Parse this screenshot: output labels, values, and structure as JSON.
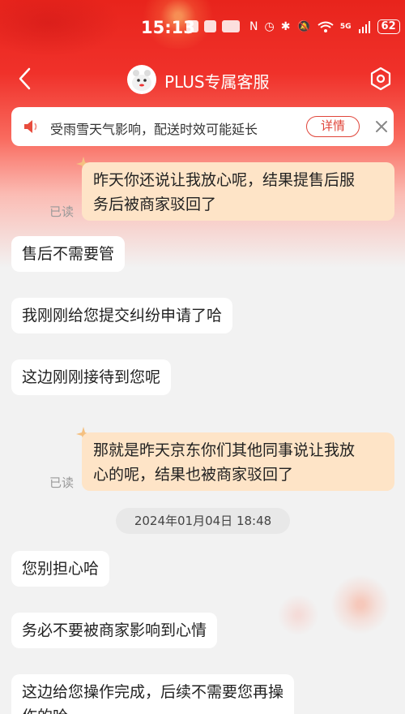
{
  "status_bar": {
    "time": "15:13",
    "battery": "62",
    "network": "5G"
  },
  "nav": {
    "title": "PLUS专属客服",
    "icons": [
      "back-icon",
      "avatar",
      "settings-icon"
    ]
  },
  "notice": {
    "text": "受雨雪天气影响，配送时效可能延长",
    "detail_label": "详情",
    "icons": [
      "speaker-icon",
      "close-icon"
    ]
  },
  "messages": [
    {
      "side": "right",
      "text_lines": [
        "昨天你还说让我放心呢，结果提售后服",
        "务后被商家驳回了"
      ],
      "read": "已读"
    },
    {
      "side": "left",
      "text": "售后不需要管"
    },
    {
      "side": "left",
      "text": "我刚刚给您提交纠纷申请了哈"
    },
    {
      "side": "left",
      "text": "这边刚刚接待到您呢"
    },
    {
      "side": "right",
      "text_lines": [
        "那就是昨天京东你们其他同事说让我放",
        "心的呢，结果也被商家驳回了"
      ],
      "read": "已读"
    },
    {
      "side": "time",
      "text": "2024年01月04日  18:48"
    },
    {
      "side": "left",
      "text": "您别担心哈"
    },
    {
      "side": "left",
      "text": "务必不要被商家影响到心情"
    },
    {
      "side": "left",
      "text_lines": [
        "这边给您操作完成，后续不需要您再操",
        "作的哈"
      ]
    }
  ],
  "colors": {
    "header_red": "#e8241c",
    "self_bubble": "#fee4c7",
    "other_bubble": "#ffffff",
    "accent": "#e0453a"
  }
}
